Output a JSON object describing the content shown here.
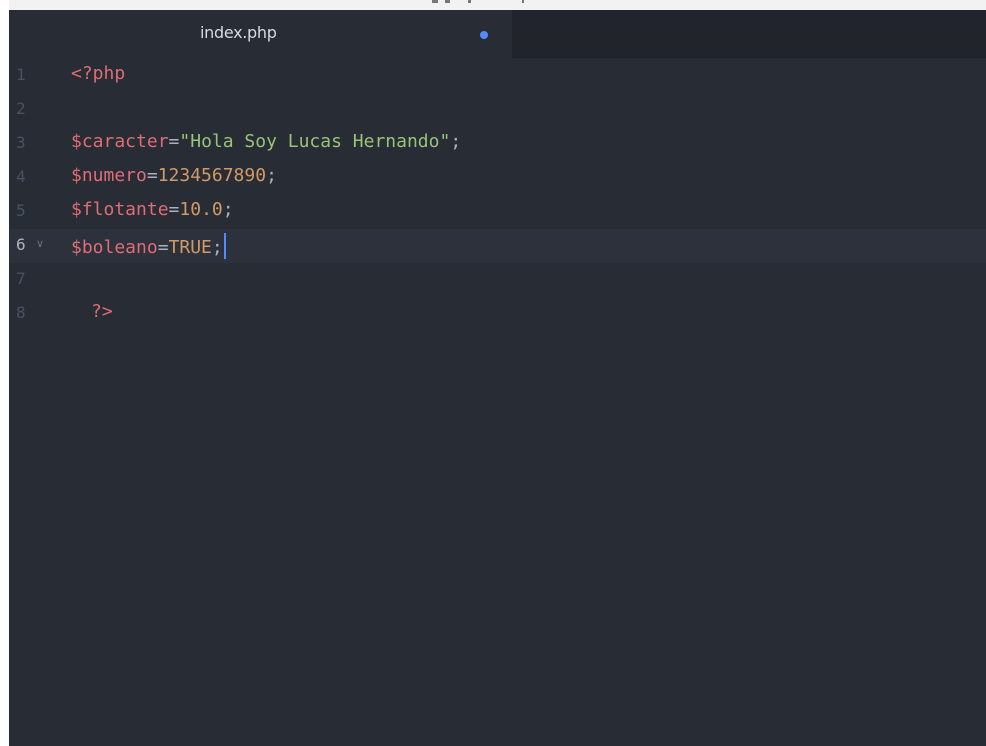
{
  "tab": {
    "title": "index.php",
    "modified": true,
    "modified_color": "#528bff"
  },
  "editor": {
    "current_line": 6,
    "lines": [
      {
        "number": "1",
        "tokens": [
          {
            "text": "<?php",
            "type": "php"
          }
        ]
      },
      {
        "number": "2",
        "tokens": []
      },
      {
        "number": "3",
        "tokens": [
          {
            "text": "$caracter",
            "type": "var"
          },
          {
            "text": "=",
            "type": "op"
          },
          {
            "text": "\"Hola Soy Lucas Hernando\"",
            "type": "str"
          },
          {
            "text": ";",
            "type": "punct"
          }
        ]
      },
      {
        "number": "4",
        "tokens": [
          {
            "text": "$numero",
            "type": "var"
          },
          {
            "text": "=",
            "type": "op"
          },
          {
            "text": "1234567890",
            "type": "num"
          },
          {
            "text": ";",
            "type": "punct"
          }
        ]
      },
      {
        "number": "5",
        "tokens": [
          {
            "text": "$flotante",
            "type": "var"
          },
          {
            "text": "=",
            "type": "op"
          },
          {
            "text": "10.0",
            "type": "num"
          },
          {
            "text": ";",
            "type": "punct"
          }
        ]
      },
      {
        "number": "6",
        "fold_icon": "chevron-down-icon",
        "tokens": [
          {
            "text": "$boleano",
            "type": "var"
          },
          {
            "text": "=",
            "type": "op"
          },
          {
            "text": "TRUE",
            "type": "const"
          },
          {
            "text": ";",
            "type": "punct"
          }
        ]
      },
      {
        "number": "7",
        "tokens": []
      },
      {
        "number": "8",
        "indented": true,
        "tokens": [
          {
            "text": "?>",
            "type": "php"
          }
        ]
      }
    ]
  },
  "colors": {
    "editor_background": "#282c34",
    "current_line": "#2c313c",
    "tab_bar": "#21252b",
    "cursor": "#528bff"
  }
}
